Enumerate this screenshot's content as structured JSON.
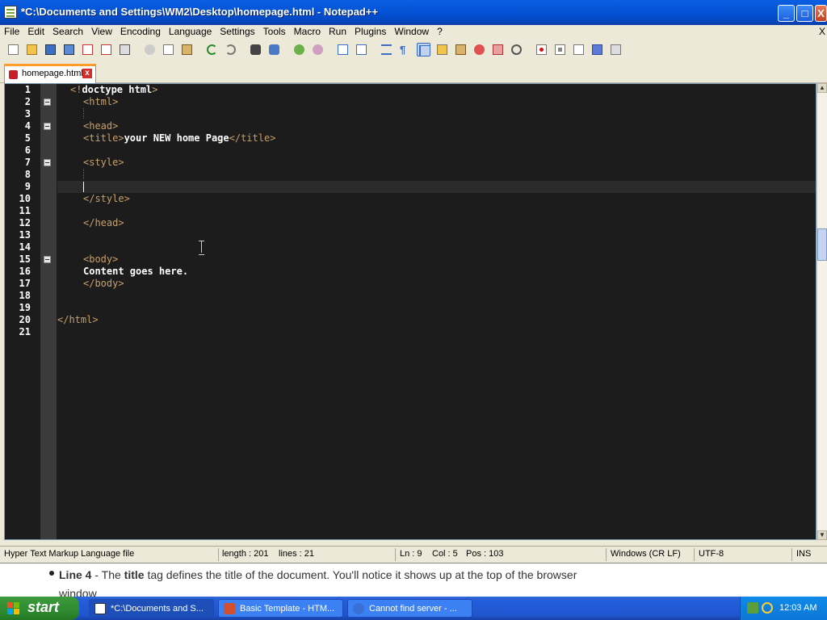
{
  "window": {
    "title": "*C:\\Documents and Settings\\WM2\\Desktop\\homepage.html - Notepad++",
    "minimize": "_",
    "maximize": "□",
    "close": "X"
  },
  "menu": {
    "items": [
      "File",
      "Edit",
      "Search",
      "View",
      "Encoding",
      "Language",
      "Settings",
      "Tools",
      "Macro",
      "Run",
      "Plugins",
      "Window",
      "?"
    ],
    "close_doc": "X"
  },
  "tab": {
    "label": "homepage.html",
    "close": "x"
  },
  "editor": {
    "current_line": 9,
    "lines": [
      {
        "n": "1",
        "indent": 2,
        "parts": [
          [
            "tag",
            "<!"
          ],
          [
            "txt",
            "doctype html"
          ],
          [
            "tag",
            ">"
          ]
        ]
      },
      {
        "n": "2",
        "indent": 4,
        "fold": true,
        "parts": [
          [
            "tag",
            "<html>"
          ]
        ]
      },
      {
        "n": "3",
        "indent": 0,
        "parts": []
      },
      {
        "n": "4",
        "indent": 4,
        "fold": true,
        "parts": [
          [
            "tag",
            "<head>"
          ]
        ]
      },
      {
        "n": "5",
        "indent": 4,
        "parts": [
          [
            "tag",
            "<title>"
          ],
          [
            "txt",
            "your NEW home Page"
          ],
          [
            "tag",
            "</title>"
          ]
        ]
      },
      {
        "n": "6",
        "indent": 0,
        "parts": []
      },
      {
        "n": "7",
        "indent": 4,
        "fold": true,
        "parts": [
          [
            "tag",
            "<style>"
          ]
        ]
      },
      {
        "n": "8",
        "indent": 0,
        "parts": []
      },
      {
        "n": "9",
        "indent": 0,
        "parts": []
      },
      {
        "n": "10",
        "indent": 4,
        "parts": [
          [
            "tag",
            "</style>"
          ]
        ]
      },
      {
        "n": "11",
        "indent": 0,
        "parts": []
      },
      {
        "n": "12",
        "indent": 4,
        "parts": [
          [
            "tag",
            "</head>"
          ]
        ]
      },
      {
        "n": "13",
        "indent": 0,
        "parts": []
      },
      {
        "n": "14",
        "indent": 0,
        "parts": []
      },
      {
        "n": "15",
        "indent": 4,
        "fold": true,
        "parts": [
          [
            "tag",
            "<body>"
          ]
        ]
      },
      {
        "n": "16",
        "indent": 4,
        "parts": [
          [
            "txt",
            "Content goes here."
          ]
        ]
      },
      {
        "n": "17",
        "indent": 4,
        "parts": [
          [
            "tag",
            "</body>"
          ]
        ]
      },
      {
        "n": "18",
        "indent": 0,
        "parts": []
      },
      {
        "n": "19",
        "indent": 0,
        "parts": []
      },
      {
        "n": "20",
        "indent": 0,
        "parts": [
          [
            "tag",
            "</html>"
          ]
        ]
      },
      {
        "n": "21",
        "indent": 0,
        "parts": []
      }
    ]
  },
  "status": {
    "file_type": "Hyper Text Markup Language file",
    "length": "length : 201",
    "lines": "lines : 21",
    "ln": "Ln : 9",
    "col": "Col : 5",
    "pos": "Pos : 103",
    "eol": "Windows (CR LF)",
    "encoding": "UTF-8",
    "mode": "INS"
  },
  "browser_snippet": {
    "bold1": "Line 4",
    "t1": " - The ",
    "bold2": "title",
    "t2": " tag defines the title of the document. You'll notice it shows up at the top of the browser",
    "line2": "window"
  },
  "taskbar": {
    "start": "start",
    "tasks": [
      "*C:\\Documents and S...",
      "Basic Template - HTM...",
      "Cannot find server - ..."
    ],
    "clock": "12:03 AM"
  },
  "colors": {
    "tag": "#c8a06a",
    "text": "#ffffff",
    "editor_bg": "#1c1c1c",
    "tab_accent": "#ff9c2a"
  }
}
